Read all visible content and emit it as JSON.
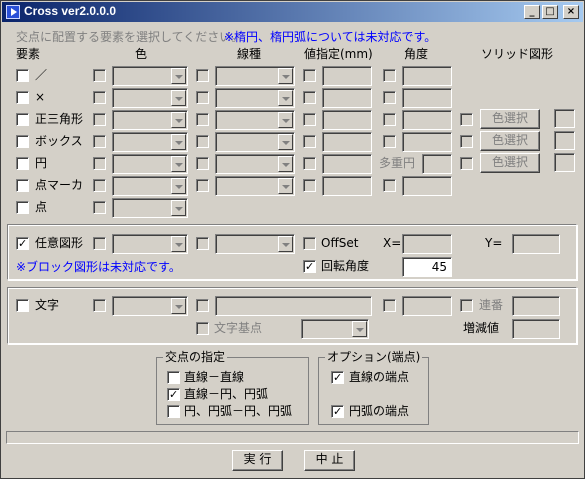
{
  "window": {
    "title": "Cross ver2.0.0.0",
    "min": "_",
    "max": "□",
    "close": "×"
  },
  "instruction": "交点に配置する要素を選択してください。",
  "note": "※楕円、楕円弧については未対応です。",
  "headers": {
    "element": "要素",
    "color": "色",
    "linetype": "線種",
    "size": "値指定(mm)",
    "angle": "角度",
    "solid": "ソリッド図形"
  },
  "rows": [
    {
      "label": "／"
    },
    {
      "label": "×"
    },
    {
      "label": "正三角形",
      "solid_button": "色選択"
    },
    {
      "label": "ボックス",
      "solid_button": "色選択"
    },
    {
      "label": "円",
      "multi_circle": "多重円",
      "solid_button": "色選択"
    },
    {
      "label": "点マーカ"
    },
    {
      "label": "点"
    }
  ],
  "arbitrary": {
    "label": "任意図形",
    "checked": true,
    "offset": "OffSet",
    "x_label": "X=",
    "y_label": "Y=",
    "block_note": "※ブロック図形は未対応です。",
    "rotate_label": "回転角度",
    "rotate_checked": true,
    "rotate_value": "45"
  },
  "text": {
    "label": "文字",
    "serial": "連番",
    "increment": "増減値",
    "basepoint": "文字基点"
  },
  "intersection": {
    "legend": "交点の指定",
    "items": [
      {
        "label": "直線－直線",
        "checked": false
      },
      {
        "label": "直線－円、円弧",
        "checked": true
      },
      {
        "label": "円、円弧－円、円弧",
        "checked": false
      }
    ]
  },
  "options": {
    "legend": "オプション(端点)",
    "items": [
      {
        "label": "直線の端点",
        "checked": true
      },
      {
        "label": "円弧の端点",
        "checked": true
      }
    ]
  },
  "buttons": {
    "run": "実 行",
    "cancel": "中 止"
  }
}
